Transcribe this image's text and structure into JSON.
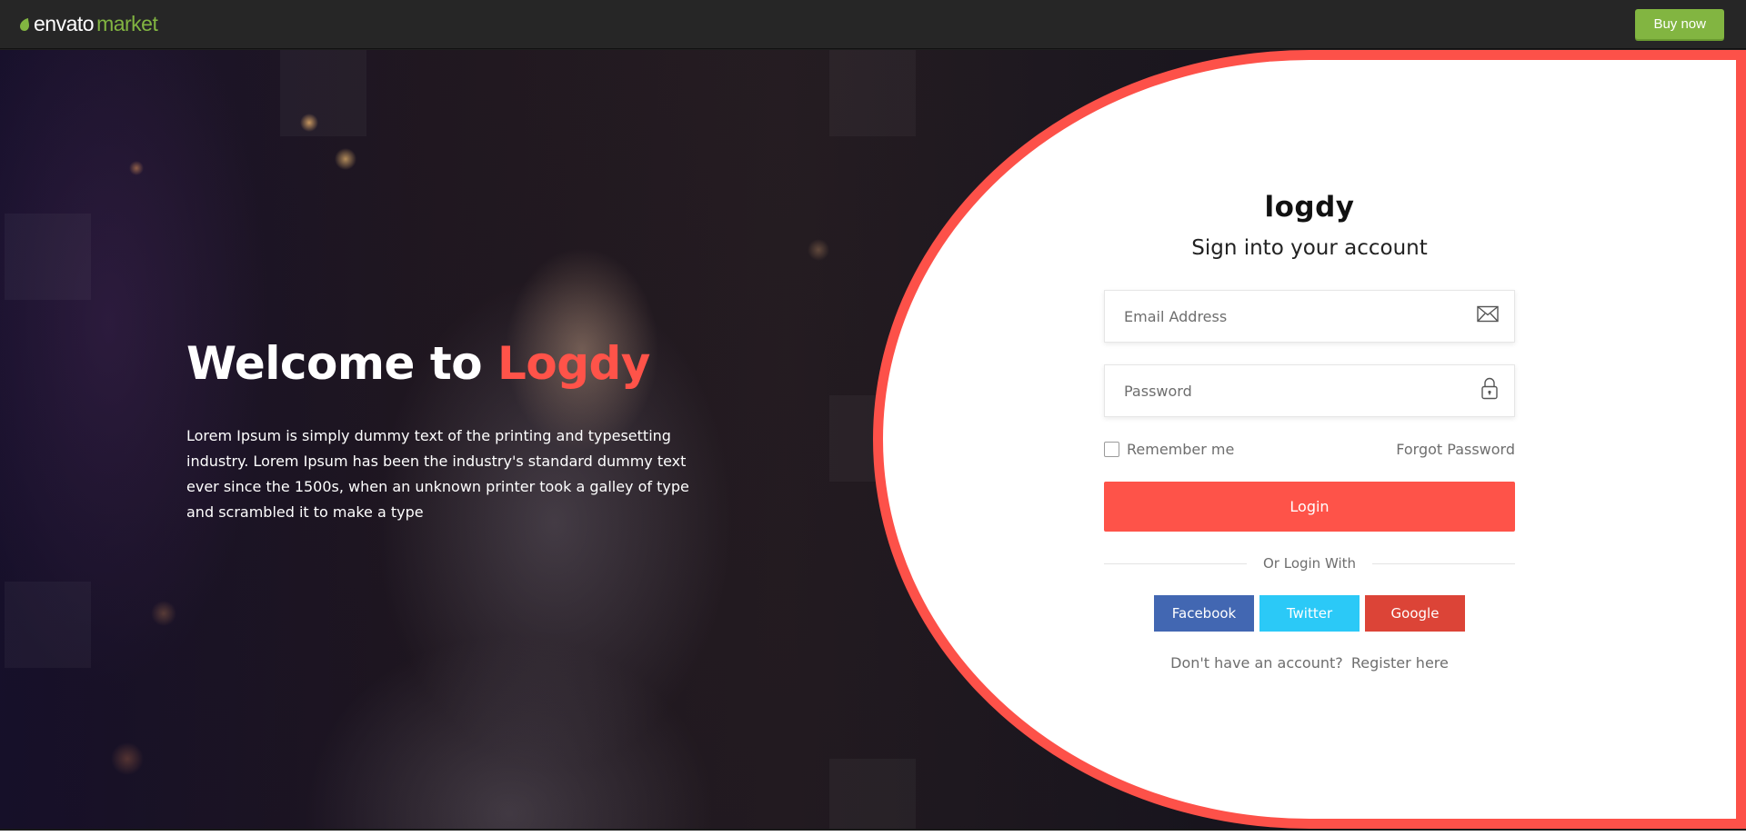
{
  "topbar": {
    "brand_envato": "envato",
    "brand_market": "market",
    "brand_icon": "envato-leaf-icon",
    "buy_label": "Buy now"
  },
  "hero": {
    "welcome_prefix": "Welcome to ",
    "welcome_accent": "Logdy",
    "description": "Lorem Ipsum is simply dummy text of the printing and typesetting industry. Lorem Ipsum has been the industry's standard dummy text ever since the 1500s, when an unknown printer took a galley of type and scrambled it to make a type"
  },
  "form": {
    "logo": "logdy",
    "subtitle": "Sign into your account",
    "email": {
      "placeholder": "Email Address",
      "value": "",
      "icon": "envelope-icon"
    },
    "password": {
      "placeholder": "Password",
      "value": "",
      "icon": "lock-icon"
    },
    "remember_label": "Remember me",
    "forgot_label": "Forgot Password",
    "login_label": "Login",
    "or_login_with": "Or Login With",
    "socials": [
      {
        "label": "Facebook",
        "color": "#4267b2"
      },
      {
        "label": "Twitter",
        "color": "#2bc9f7"
      },
      {
        "label": "Google",
        "color": "#dc4437"
      }
    ],
    "no_account": "Don't have an account?",
    "register_label": "Register here"
  },
  "colors": {
    "accent": "#fd5149",
    "envato_green": "#82b541"
  }
}
